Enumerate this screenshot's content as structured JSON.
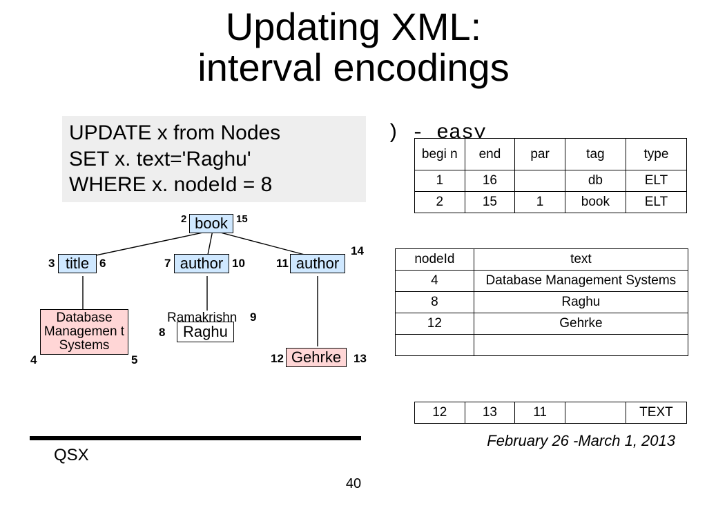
{
  "title_l1": "Updating XML:",
  "title_l2": "interval encodings",
  "easy_suffix": ") - easy",
  "sql": {
    "l1": "UPDATE x from Nodes",
    "l2": "SET x. text='Raghu'",
    "l3": "WHERE x. nodeId = 8"
  },
  "tree": {
    "n2": "2",
    "book": "book",
    "n15": "15",
    "n3": "3",
    "title": "title",
    "n6": "6",
    "n7": "7",
    "author1": "author",
    "n10": "10",
    "n11": "11",
    "author2": "author",
    "n14": "14",
    "n4": "4",
    "dbms": "Database Managemen t Systems",
    "n5": "5",
    "n8": "8",
    "rama_old": "Ramakrishn",
    "n9": "9",
    "rama_new": "Raghu",
    "n12": "12",
    "gehrke": "Gehrke",
    "n13": "13"
  },
  "nodes_tbl": {
    "h": {
      "begin": "begi n",
      "end": "end",
      "par": "par",
      "tag": "tag",
      "type": "type"
    },
    "r1": {
      "b": "1",
      "e": "16",
      "p": "",
      "tag": "db",
      "ty": "ELT"
    },
    "r2": {
      "b": "2",
      "e": "15",
      "p": "1",
      "tag": "book",
      "ty": "ELT"
    },
    "last": {
      "b": "12",
      "e": "13",
      "p": "11",
      "tag": "",
      "ty": "TEXT"
    }
  },
  "text_tbl": {
    "h": {
      "id": "nodeId",
      "text": "text"
    },
    "r1": {
      "id": "4",
      "text": "Database Management Systems"
    },
    "r2": {
      "id": "8",
      "text": "Raghu"
    },
    "r3": {
      "id": "12",
      "text": "Gehrke"
    }
  },
  "footer": {
    "qsx": "QSX",
    "date": "February 26 -March 1, 2013",
    "page": "40"
  }
}
